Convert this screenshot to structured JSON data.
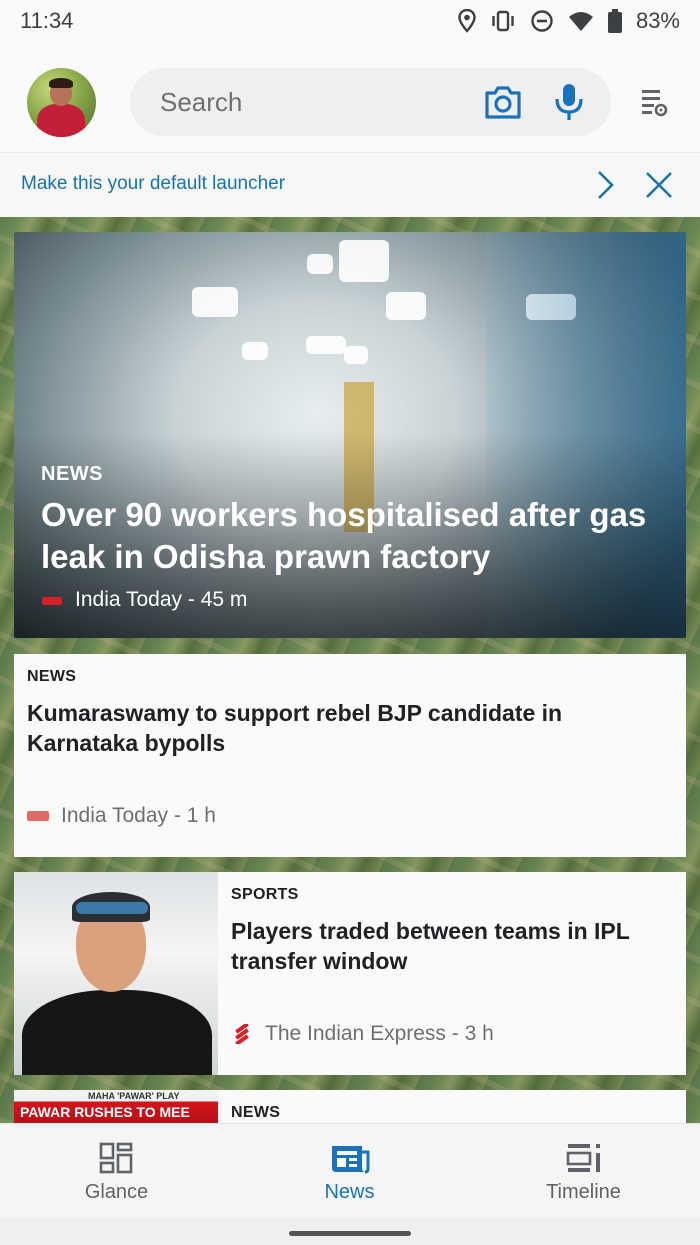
{
  "status_bar": {
    "time": "11:34",
    "battery": "83%",
    "icons": [
      "location-icon",
      "vibrate-icon",
      "do-not-disturb-icon",
      "wifi-icon",
      "battery-icon"
    ]
  },
  "header": {
    "search_placeholder": "Search",
    "accent_color": "#1a73b8"
  },
  "launcher_banner": {
    "text": "Make this your default launcher"
  },
  "feed": {
    "hero": {
      "category": "NEWS",
      "title": "Over 90 workers hospitalised after gas leak in Odisha prawn factory",
      "source": "India Today - 45 m"
    },
    "cards": [
      {
        "category": "NEWS",
        "title": "Kumaraswamy to support rebel BJP candidate in Karnataka bypolls",
        "source": "India Today - 1 h"
      },
      {
        "category": "SPORTS",
        "title": "Players traded between teams in IPL transfer window",
        "source": "The Indian Express - 3 h"
      },
      {
        "category": "NEWS",
        "thumb_line1": "MAHA 'PAWAR' PLAY",
        "thumb_line2": "PAWAR RUSHES TO MEE"
      }
    ]
  },
  "bottom_nav": {
    "items": [
      {
        "label": "Glance",
        "icon": "glance-icon"
      },
      {
        "label": "News",
        "icon": "news-icon",
        "active": true
      },
      {
        "label": "Timeline",
        "icon": "timeline-icon"
      }
    ]
  }
}
